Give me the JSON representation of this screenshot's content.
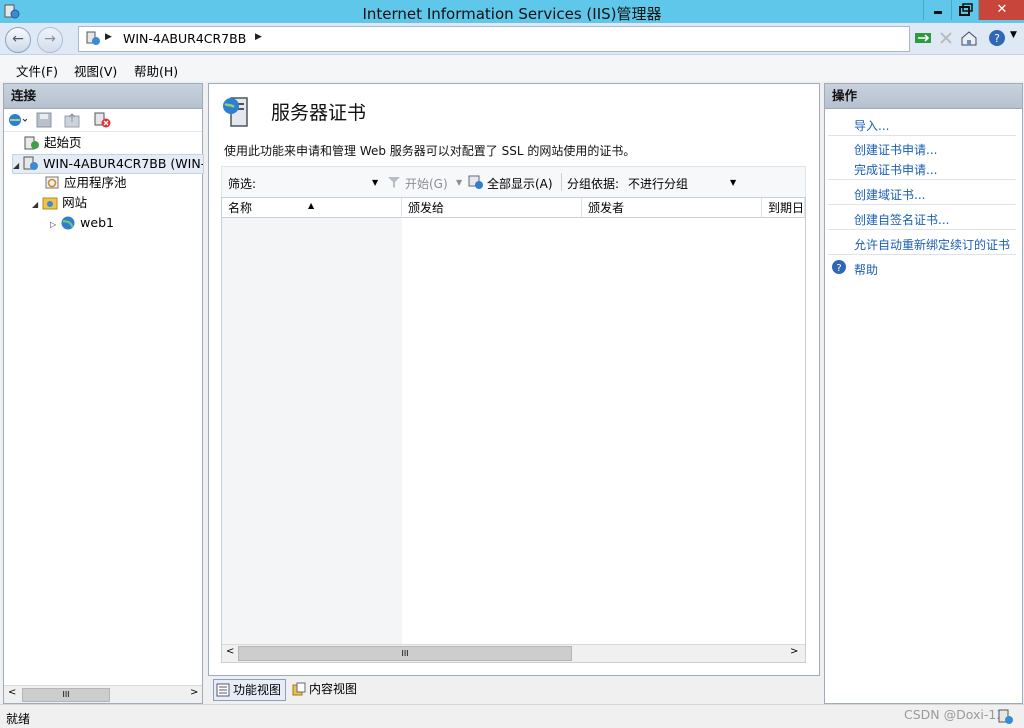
{
  "window": {
    "title": "Internet Information Services (IIS)管理器"
  },
  "address": {
    "server": "WIN-4ABUR4CR7BB"
  },
  "menu": [
    "文件(F)",
    "视图(V)",
    "帮助(H)"
  ],
  "connections": {
    "title": "连接",
    "tree": [
      {
        "label": "起始页",
        "icon": "start-page-icon"
      },
      {
        "label": "WIN-4ABUR4CR7BB (WIN-",
        "icon": "server-icon"
      },
      {
        "label": "应用程序池",
        "icon": "app-pool-icon"
      },
      {
        "label": "网站",
        "icon": "sites-folder-icon"
      },
      {
        "label": "web1",
        "icon": "globe-icon"
      }
    ],
    "hscroll_grip": "III"
  },
  "main": {
    "title": "服务器证书",
    "description": "使用此功能来申请和管理 Web 服务器可以对配置了 SSL 的网站使用的证书。",
    "filter": {
      "label": "筛选:",
      "start_label": "开始(G)",
      "show_all_label": "全部显示(A)",
      "group_by_label": "分组依据:",
      "group_by_value": "不进行分组"
    },
    "columns": [
      "名称",
      "颁发给",
      "颁发者",
      "到期日"
    ],
    "hscroll_grip": "III"
  },
  "actions": {
    "title": "操作",
    "items": [
      "导入...",
      "创建证书申请...",
      "完成证书申请...",
      "创建域证书...",
      "创建自签名证书...",
      "允许自动重新绑定续订的证书"
    ],
    "help": "帮助"
  },
  "views": {
    "features_view": "功能视图",
    "content_view": "内容视图"
  },
  "status": {
    "text": "就绪",
    "watermark": "CSDN @Doxi-13"
  },
  "colors": {
    "titlebar": "#5fc7ea",
    "close": "#c7453a",
    "link": "#1a5fb4"
  }
}
